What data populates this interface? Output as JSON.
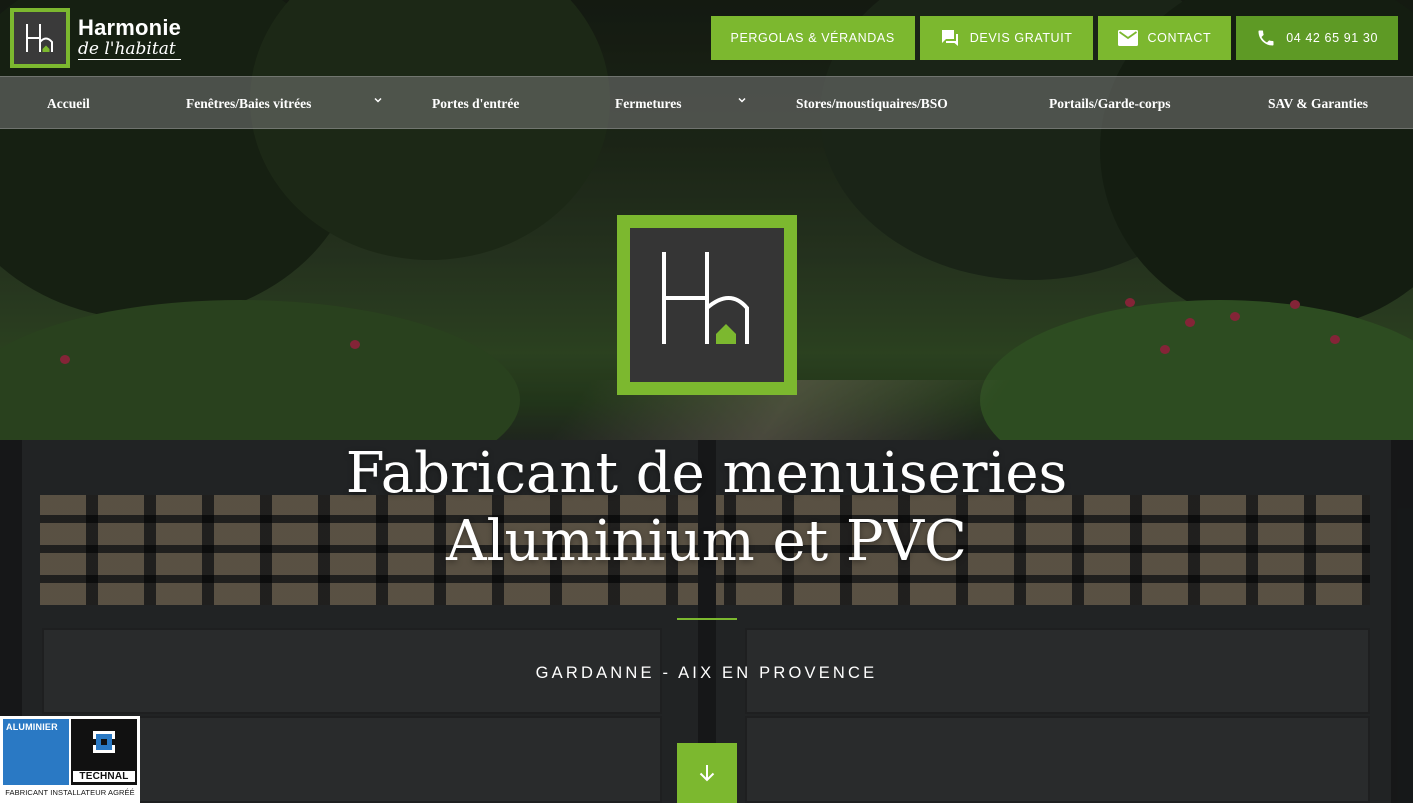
{
  "brand": {
    "name_line1": "Harmonie",
    "name_line2": "de l'habitat"
  },
  "top_buttons": [
    {
      "label": "PERGOLAS & VÉRANDAS",
      "icon": "none"
    },
    {
      "label": "DEVIS GRATUIT",
      "icon": "chat-bubbles-icon"
    },
    {
      "label": "CONTACT",
      "icon": "mail-icon"
    },
    {
      "label": "04 42 65 91 30",
      "icon": "phone-icon"
    }
  ],
  "nav": {
    "items": [
      {
        "label": "Accueil",
        "has_dropdown": false
      },
      {
        "label": "Fenêtres/Baies vitrées",
        "has_dropdown": true
      },
      {
        "label": "Portes d'entrée",
        "has_dropdown": false
      },
      {
        "label": "Fermetures",
        "has_dropdown": true
      },
      {
        "label": "Stores/moustiquaires/BSO",
        "has_dropdown": false
      },
      {
        "label": "Portails/Garde-corps",
        "has_dropdown": false
      },
      {
        "label": "SAV & Garanties",
        "has_dropdown": false
      }
    ]
  },
  "hero": {
    "headline_line1": "Fabricant de menuiseries",
    "headline_line2": "Aluminium et PVC",
    "subtitle": "GARDANNE - AIX EN PROVENCE",
    "scroll_icon": "arrow-down-icon"
  },
  "badge": {
    "left_label": "ALUMINIER",
    "right_label": "TECHNAL",
    "bottom_label": "FABRICANT INSTALLATEUR AGRÉÉ"
  },
  "colors": {
    "accent_green": "#7cb82f",
    "accent_green_dark": "#5e9a25",
    "nav_bg": "#787878",
    "logo_bg": "#353535"
  }
}
